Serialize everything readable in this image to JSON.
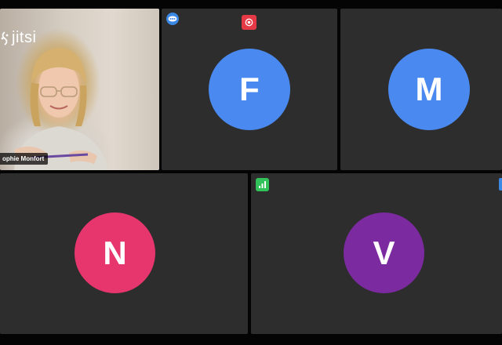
{
  "app": {
    "logo_text": "jitsi",
    "logo_icon": "jitsi-logo-icon"
  },
  "participants": [
    {
      "type": "video",
      "name": "ophie Monfort",
      "active": true
    },
    {
      "type": "avatar",
      "initial": "F",
      "color": "#4a8af0",
      "indicator": "record-icon",
      "indicator_color": "#e53945"
    },
    {
      "type": "avatar",
      "initial": "M",
      "color": "#4a8af0"
    },
    {
      "type": "avatar",
      "initial": "N",
      "color": "#e7366d"
    },
    {
      "type": "avatar",
      "initial": "V",
      "color": "#7c2aa0",
      "indicator": "connection-signal-icon",
      "indicator_color": "#32c25a"
    }
  ],
  "colors": {
    "background": "#040404",
    "tile": "#2d2d2d",
    "active_border": "#3f7ee8",
    "moderator_badge": "#3b87e4"
  }
}
